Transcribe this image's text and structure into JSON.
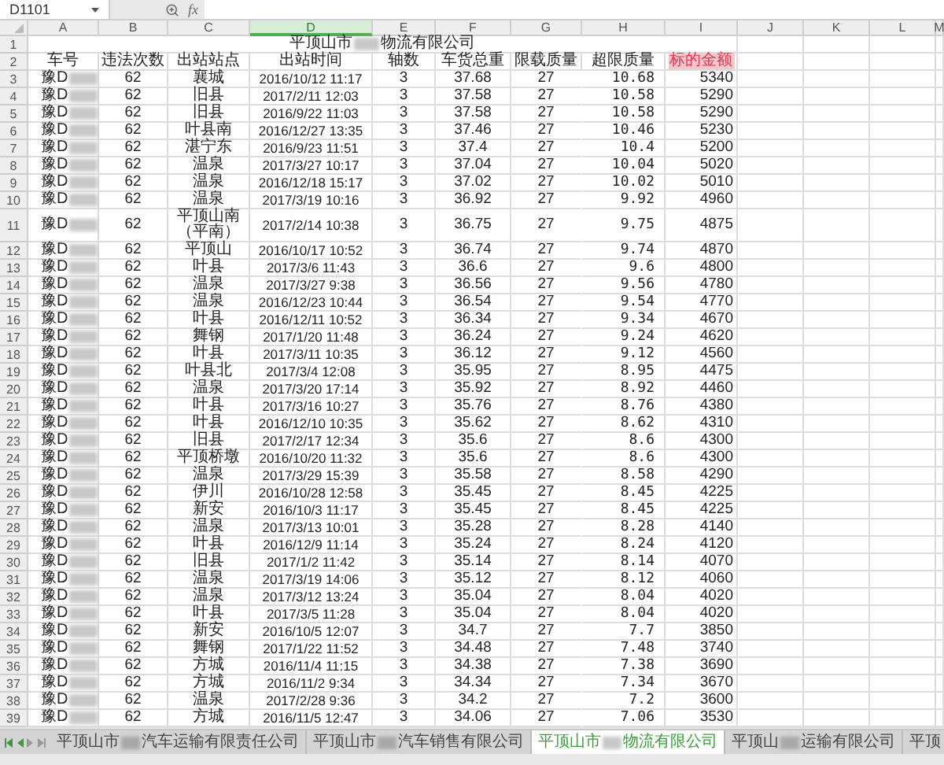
{
  "name_box": "D1101",
  "formula_label": "fx",
  "columns": [
    {
      "label": "A",
      "selected": false
    },
    {
      "label": "B",
      "selected": false
    },
    {
      "label": "C",
      "selected": false
    },
    {
      "label": "D",
      "selected": true
    },
    {
      "label": "E",
      "selected": false
    },
    {
      "label": "F",
      "selected": false
    },
    {
      "label": "G",
      "selected": false
    },
    {
      "label": "H",
      "selected": false
    },
    {
      "label": "I",
      "selected": false
    },
    {
      "label": "J",
      "selected": false
    },
    {
      "label": "K",
      "selected": false
    },
    {
      "label": "L",
      "selected": false
    },
    {
      "label": "M",
      "selected": false
    }
  ],
  "title": {
    "row": "1",
    "before": "平顶山市",
    "after": "物流有限公司"
  },
  "header": {
    "row": "2",
    "cells": [
      {
        "text": "车号",
        "highlighted": false
      },
      {
        "text": "违法次数",
        "highlighted": false
      },
      {
        "text": "出站站点",
        "highlighted": false
      },
      {
        "text": "出站时间",
        "highlighted": false
      },
      {
        "text": "轴数",
        "highlighted": false
      },
      {
        "text": "车货总重",
        "highlighted": false
      },
      {
        "text": "限载质量",
        "highlighted": false
      },
      {
        "text": "超限质量",
        "highlighted": false
      },
      {
        "text": "标的金额",
        "highlighted": true
      }
    ]
  },
  "rows": [
    {
      "n": "3",
      "cells": [
        "豫D",
        "62",
        "襄城",
        "2016/10/12 11:17",
        "3",
        "37.68",
        "27",
        "10.68",
        "5340"
      ]
    },
    {
      "n": "4",
      "cells": [
        "豫D",
        "62",
        "旧县",
        "2017/2/11 12:03",
        "3",
        "37.58",
        "27",
        "10.58",
        "5290"
      ]
    },
    {
      "n": "5",
      "cells": [
        "豫D",
        "62",
        "旧县",
        "2016/9/22 11:03",
        "3",
        "37.58",
        "27",
        "10.58",
        "5290"
      ]
    },
    {
      "n": "6",
      "cells": [
        "豫D",
        "62",
        "叶县南",
        "2016/12/27 13:35",
        "3",
        "37.46",
        "27",
        "10.46",
        "5230"
      ]
    },
    {
      "n": "7",
      "cells": [
        "豫D",
        "62",
        "湛宁东",
        "2016/9/23 11:51",
        "3",
        "37.4",
        "27",
        "10.4",
        "5200"
      ]
    },
    {
      "n": "8",
      "cells": [
        "豫D",
        "62",
        "温泉",
        "2017/3/27 10:17",
        "3",
        "37.04",
        "27",
        "10.04",
        "5020"
      ]
    },
    {
      "n": "9",
      "cells": [
        "豫D",
        "62",
        "温泉",
        "2016/12/18 15:17",
        "3",
        "37.02",
        "27",
        "10.02",
        "5010"
      ]
    },
    {
      "n": "10",
      "cells": [
        "豫D",
        "62",
        "温泉",
        "2017/3/19 10:16",
        "3",
        "36.92",
        "27",
        "9.92",
        "4960"
      ]
    },
    {
      "n": "11",
      "cells": [
        "豫D",
        "62",
        "平顶山南（平南）",
        "2017/2/14 10:38",
        "3",
        "36.75",
        "27",
        "9.75",
        "4875"
      ]
    },
    {
      "n": "12",
      "cells": [
        "豫D",
        "62",
        "平顶山",
        "2016/10/17 10:52",
        "3",
        "36.74",
        "27",
        "9.74",
        "4870"
      ]
    },
    {
      "n": "13",
      "cells": [
        "豫D",
        "62",
        "叶县",
        "2017/3/6 11:43",
        "3",
        "36.6",
        "27",
        "9.6",
        "4800"
      ]
    },
    {
      "n": "14",
      "cells": [
        "豫D",
        "62",
        "温泉",
        "2017/3/27 9:38",
        "3",
        "36.56",
        "27",
        "9.56",
        "4780"
      ]
    },
    {
      "n": "15",
      "cells": [
        "豫D",
        "62",
        "温泉",
        "2016/12/23 10:44",
        "3",
        "36.54",
        "27",
        "9.54",
        "4770"
      ]
    },
    {
      "n": "16",
      "cells": [
        "豫D",
        "62",
        "叶县",
        "2016/12/11 10:52",
        "3",
        "36.34",
        "27",
        "9.34",
        "4670"
      ]
    },
    {
      "n": "17",
      "cells": [
        "豫D",
        "62",
        "舞钢",
        "2017/1/20 11:48",
        "3",
        "36.24",
        "27",
        "9.24",
        "4620"
      ]
    },
    {
      "n": "18",
      "cells": [
        "豫D",
        "62",
        "叶县",
        "2017/3/11 10:35",
        "3",
        "36.12",
        "27",
        "9.12",
        "4560"
      ]
    },
    {
      "n": "19",
      "cells": [
        "豫D",
        "62",
        "叶县北",
        "2017/3/4 12:08",
        "3",
        "35.95",
        "27",
        "8.95",
        "4475"
      ]
    },
    {
      "n": "20",
      "cells": [
        "豫D",
        "62",
        "温泉",
        "2017/3/20 17:14",
        "3",
        "35.92",
        "27",
        "8.92",
        "4460"
      ]
    },
    {
      "n": "21",
      "cells": [
        "豫D",
        "62",
        "叶县",
        "2017/3/16 10:27",
        "3",
        "35.76",
        "27",
        "8.76",
        "4380"
      ]
    },
    {
      "n": "22",
      "cells": [
        "豫D",
        "62",
        "叶县",
        "2016/12/10 10:35",
        "3",
        "35.62",
        "27",
        "8.62",
        "4310"
      ]
    },
    {
      "n": "23",
      "cells": [
        "豫D",
        "62",
        "旧县",
        "2017/2/17 12:34",
        "3",
        "35.6",
        "27",
        "8.6",
        "4300"
      ]
    },
    {
      "n": "24",
      "cells": [
        "豫D",
        "62",
        "平顶桥墩",
        "2016/10/20 11:32",
        "3",
        "35.6",
        "27",
        "8.6",
        "4300"
      ]
    },
    {
      "n": "25",
      "cells": [
        "豫D",
        "62",
        "温泉",
        "2017/3/29 15:39",
        "3",
        "35.58",
        "27",
        "8.58",
        "4290"
      ]
    },
    {
      "n": "26",
      "cells": [
        "豫D",
        "62",
        "伊川",
        "2016/10/28 12:58",
        "3",
        "35.45",
        "27",
        "8.45",
        "4225"
      ]
    },
    {
      "n": "27",
      "cells": [
        "豫D",
        "62",
        "新安",
        "2016/10/3 11:17",
        "3",
        "35.45",
        "27",
        "8.45",
        "4225"
      ]
    },
    {
      "n": "28",
      "cells": [
        "豫D",
        "62",
        "温泉",
        "2017/3/13 10:01",
        "3",
        "35.28",
        "27",
        "8.28",
        "4140"
      ]
    },
    {
      "n": "29",
      "cells": [
        "豫D",
        "62",
        "叶县",
        "2016/12/9 11:14",
        "3",
        "35.24",
        "27",
        "8.24",
        "4120"
      ]
    },
    {
      "n": "30",
      "cells": [
        "豫D",
        "62",
        "旧县",
        "2017/1/2 11:42",
        "3",
        "35.14",
        "27",
        "8.14",
        "4070"
      ]
    },
    {
      "n": "31",
      "cells": [
        "豫D",
        "62",
        "温泉",
        "2017/3/19 14:06",
        "3",
        "35.12",
        "27",
        "8.12",
        "4060"
      ]
    },
    {
      "n": "32",
      "cells": [
        "豫D",
        "62",
        "温泉",
        "2017/3/12 13:24",
        "3",
        "35.04",
        "27",
        "8.04",
        "4020"
      ]
    },
    {
      "n": "33",
      "cells": [
        "豫D",
        "62",
        "叶县",
        "2017/3/5 11:28",
        "3",
        "35.04",
        "27",
        "8.04",
        "4020"
      ]
    },
    {
      "n": "34",
      "cells": [
        "豫D",
        "62",
        "新安",
        "2016/10/5 12:07",
        "3",
        "34.7",
        "27",
        "7.7",
        "3850"
      ]
    },
    {
      "n": "35",
      "cells": [
        "豫D",
        "62",
        "舞钢",
        "2017/1/22 11:52",
        "3",
        "34.48",
        "27",
        "7.48",
        "3740"
      ]
    },
    {
      "n": "36",
      "cells": [
        "豫D",
        "62",
        "方城",
        "2016/11/4 11:15",
        "3",
        "34.38",
        "27",
        "7.38",
        "3690"
      ]
    },
    {
      "n": "37",
      "cells": [
        "豫D",
        "62",
        "方城",
        "2016/11/2 9:34",
        "3",
        "34.34",
        "27",
        "7.34",
        "3670"
      ]
    },
    {
      "n": "38",
      "cells": [
        "豫D",
        "62",
        "温泉",
        "2017/2/28 9:36",
        "3",
        "34.2",
        "27",
        "7.2",
        "3600"
      ]
    },
    {
      "n": "39",
      "cells": [
        "豫D",
        "62",
        "方城",
        "2016/11/5 12:47",
        "3",
        "34.06",
        "27",
        "7.06",
        "3530"
      ]
    }
  ],
  "sheet_tabs": [
    {
      "before": "平顶山市",
      "after": "汽车运输有限责任公司",
      "selected": false
    },
    {
      "before": "平顶山市",
      "after": "汽车销售有限公司",
      "selected": false
    },
    {
      "before": "平顶山市",
      "after": "物流有限公司",
      "selected": true
    },
    {
      "before": "平顶山",
      "after": "运输有限公司",
      "selected": false
    },
    {
      "before": "平顶",
      "selected": false
    }
  ]
}
